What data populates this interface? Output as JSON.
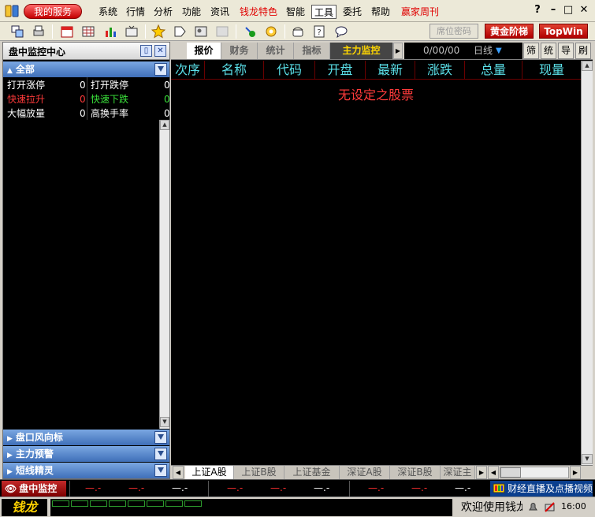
{
  "menubar": {
    "my_service": "我的服务",
    "items": [
      {
        "label": "系统",
        "color": "black"
      },
      {
        "label": "行情",
        "color": "black"
      },
      {
        "label": "分析",
        "color": "black"
      },
      {
        "label": "功能",
        "color": "black"
      },
      {
        "label": "资讯",
        "color": "black"
      },
      {
        "label": "钱龙特色",
        "color": "red"
      },
      {
        "label": "智能",
        "color": "black"
      },
      {
        "label": "工具",
        "color": "black",
        "active": true
      },
      {
        "label": "委托",
        "color": "black"
      },
      {
        "label": "帮助",
        "color": "black"
      },
      {
        "label": "赢家周刊",
        "color": "red"
      }
    ],
    "help_glyph": "?",
    "min_glyph": "–",
    "max_glyph": "□",
    "close_glyph": "✕"
  },
  "toolbar": {
    "seat_password": "席位密码",
    "golden_ladder": "黄金阶梯",
    "topwin": "TopWin"
  },
  "left_panel": {
    "title": "盘中监控中心",
    "section_all": "全部",
    "stats": [
      {
        "left_label": "打开涨停",
        "left_value": "0",
        "left_color": "#ffffff",
        "right_label": "打开跌停",
        "right_value": "0",
        "right_color": "#ffffff"
      },
      {
        "left_label": "快速拉升",
        "left_value": "0",
        "left_color": "#ff3a3a",
        "right_label": "快速下跌",
        "right_value": "0",
        "right_color": "#3ae03a"
      },
      {
        "left_label": "大幅放量",
        "left_value": "0",
        "left_color": "#ffffff",
        "right_label": "高换手率",
        "right_value": "0",
        "right_color": "#ffffff"
      }
    ],
    "bottom_sections": [
      "盘口风向标",
      "主力预警",
      "短线精灵"
    ]
  },
  "right_panel": {
    "tabs": [
      "报价",
      "财务",
      "统计",
      "指标",
      "主力监控"
    ],
    "date": "0/00/00",
    "period": "日线",
    "mini_buttons": [
      "筛",
      "统",
      "导",
      "刷"
    ],
    "columns": [
      "次序",
      "名称",
      "代码",
      "开盘",
      "最新",
      "涨跌",
      "总量",
      "现量"
    ],
    "empty_message": "无设定之股票",
    "bottom_tabs": [
      "上证A股",
      "上证B股",
      "上证基金",
      "深证A股",
      "深证B股",
      "深证主"
    ]
  },
  "status": {
    "monitor_label": "盘中监控",
    "dashes": "—.-",
    "news_label": "财经直播及点播视频",
    "logo": "钱龙",
    "welcome": "欢迎使用钱龙",
    "time": "16:00"
  }
}
